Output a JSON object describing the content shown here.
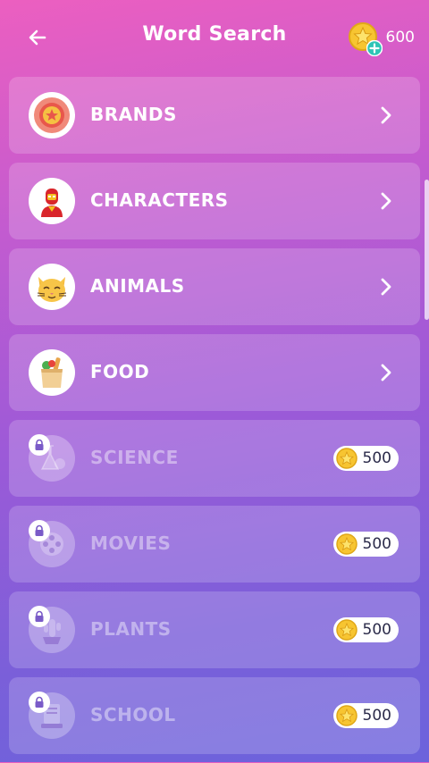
{
  "header": {
    "title": "Word Search",
    "coins": "600"
  },
  "categories": [
    {
      "label": "BRANDS",
      "icon": "brands-badge-icon",
      "locked": false
    },
    {
      "label": "CHARACTERS",
      "icon": "superhero-icon",
      "locked": false
    },
    {
      "label": "ANIMALS",
      "icon": "cat-face-icon",
      "locked": false
    },
    {
      "label": "FOOD",
      "icon": "grocery-bag-icon",
      "locked": false
    },
    {
      "label": "SCIENCE",
      "icon": "flask-icon",
      "locked": true,
      "price": "500"
    },
    {
      "label": "MOVIES",
      "icon": "film-reel-icon",
      "locked": true,
      "price": "500"
    },
    {
      "label": "PLANTS",
      "icon": "cactus-icon",
      "locked": true,
      "price": "500"
    },
    {
      "label": "SCHOOL",
      "icon": "book-icon",
      "locked": true,
      "price": "500"
    }
  ],
  "colors": {
    "gradient_top": "#ec5fc0",
    "gradient_bottom": "#6b63dc",
    "coin_gold": "#f7c531",
    "plus_teal": "#2ec4b6"
  }
}
